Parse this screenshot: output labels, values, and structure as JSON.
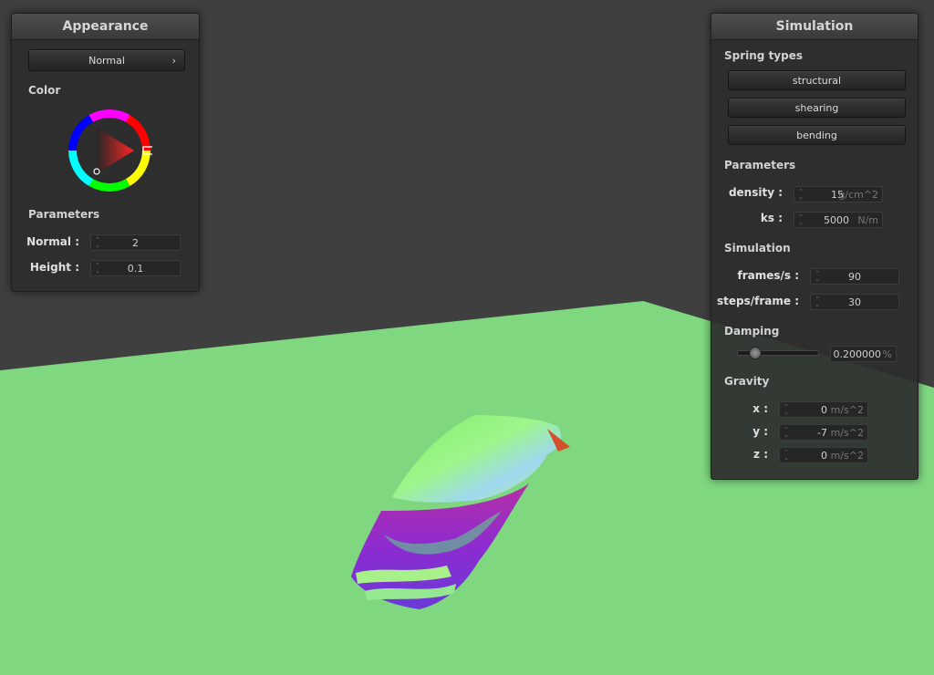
{
  "appearance": {
    "title": "Appearance",
    "shader_select": "Normal",
    "color_label": "Color",
    "parameters_label": "Parameters",
    "params": [
      {
        "label": "Normal :",
        "value": "2"
      },
      {
        "label": "Height :",
        "value": "0.1"
      }
    ],
    "wheel_selected_hue": "#ff0000"
  },
  "simulation": {
    "title": "Simulation",
    "spring_types_label": "Spring types",
    "spring_buttons": [
      "structural",
      "shearing",
      "bending"
    ],
    "parameters_label": "Parameters",
    "density": {
      "label": "density :",
      "value": "15",
      "unit": "g/cm^2"
    },
    "ks": {
      "label": "ks :",
      "value": "5000",
      "unit": "N/m"
    },
    "simulation_label": "Simulation",
    "frames": {
      "label": "frames/s :",
      "value": "90"
    },
    "steps": {
      "label": "steps/frame :",
      "value": "30"
    },
    "damping_label": "Damping",
    "damping": {
      "value": "0.200000",
      "unit": "%",
      "slider_fraction": 0.2
    },
    "gravity_label": "Gravity",
    "gravity": [
      {
        "label": "x :",
        "value": "0",
        "unit": "m/s^2"
      },
      {
        "label": "y :",
        "value": "-7",
        "unit": "m/s^2"
      },
      {
        "label": "z :",
        "value": "0",
        "unit": "m/s^2"
      }
    ]
  },
  "colors": {
    "background": "#3f3f3f",
    "ground": "#7fd880",
    "cloth_top": "#8ef07a",
    "cloth_side": "#a52fbe"
  }
}
